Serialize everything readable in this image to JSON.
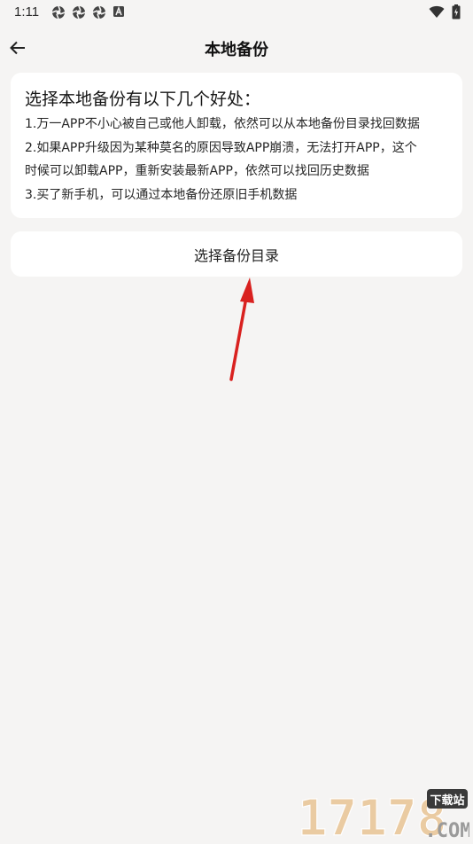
{
  "status": {
    "time": "1:11"
  },
  "header": {
    "title": "本地备份"
  },
  "info": {
    "heading": "选择本地备份有以下几个好处：",
    "lines": [
      "1.万一APP不小心被自己或他人卸载，依然可以从本地备份目录找回数据",
      "2.如果APP升级因为某种莫名的原因导致APP崩溃，无法打开APP，这个",
      "时候可以卸载APP，重新安装最新APP，依然可以找回历史数据",
      "3.买了新手机，可以通过本地备份还原旧手机数据"
    ]
  },
  "actions": {
    "select_dir": "选择备份目录"
  },
  "watermark": {
    "number": "17178",
    "badge": "下载站",
    "suffix": ".COM"
  },
  "colors": {
    "background": "#f5f4f3",
    "card": "#ffffff",
    "arrow": "#d9211f",
    "watermark": "#e9c79a"
  }
}
